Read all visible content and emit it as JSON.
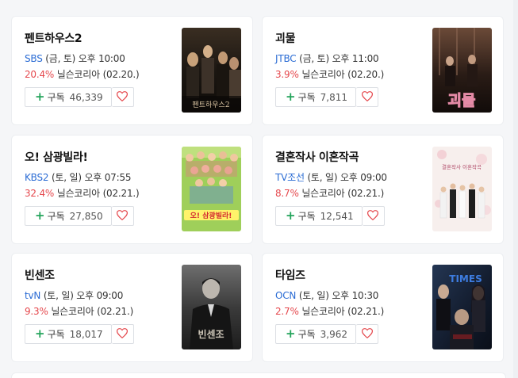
{
  "shows": [
    {
      "title": "펜트하우스2",
      "channel": "SBS",
      "schedule": "(금, 토) 오후 10:00",
      "rating": "20.4%",
      "rating_source": "닐슨코리아 (02.20.)",
      "subscribe_label": "구독",
      "subscribe_count": "46,339",
      "poster_text": "펜트하우스2",
      "poster_icon": "penthouse-poster"
    },
    {
      "title": "괴물",
      "channel": "JTBC",
      "schedule": "(금, 토) 오후 11:00",
      "rating": "3.9%",
      "rating_source": "닐슨코리아 (02.20.)",
      "subscribe_label": "구독",
      "subscribe_count": "7,811",
      "poster_text": "괴물",
      "poster_icon": "beyond-evil-poster"
    },
    {
      "title": "오! 삼광빌라!",
      "channel": "KBS2",
      "schedule": "(토, 일) 오후 07:55",
      "rating": "32.4%",
      "rating_source": "닐슨코리아 (02.21.)",
      "subscribe_label": "구독",
      "subscribe_count": "27,850",
      "poster_text": "오! 삼광빌라!",
      "poster_icon": "samgwang-villa-poster"
    },
    {
      "title": "결혼작사 이혼작곡",
      "channel": "TV조선",
      "schedule": "(토, 일) 오후 09:00",
      "rating": "8.7%",
      "rating_source": "닐슨코리아 (02.21.)",
      "subscribe_label": "구독",
      "subscribe_count": "12,541",
      "poster_text": "결혼작사 이혼작곡",
      "poster_icon": "love-marriage-divorce-poster"
    },
    {
      "title": "빈센조",
      "channel": "tvN",
      "schedule": "(토, 일) 오후 09:00",
      "rating": "9.3%",
      "rating_source": "닐슨코리아 (02.21.)",
      "subscribe_label": "구독",
      "subscribe_count": "18,017",
      "poster_text": "빈센조",
      "poster_icon": "vincenzo-poster"
    },
    {
      "title": "타임즈",
      "channel": "OCN",
      "schedule": "(토, 일) 오후 10:30",
      "rating": "2.7%",
      "rating_source": "닐슨코리아 (02.21.)",
      "subscribe_label": "구독",
      "subscribe_count": "3,962",
      "poster_text": "TIMES",
      "poster_icon": "times-poster"
    }
  ],
  "colors": {
    "channel": "#2b6cd4",
    "rating": "#e5484d",
    "plus": "#22a35a",
    "heart": "#e5484d"
  },
  "icons": {
    "plus": "plus-icon",
    "heart": "heart-icon"
  }
}
